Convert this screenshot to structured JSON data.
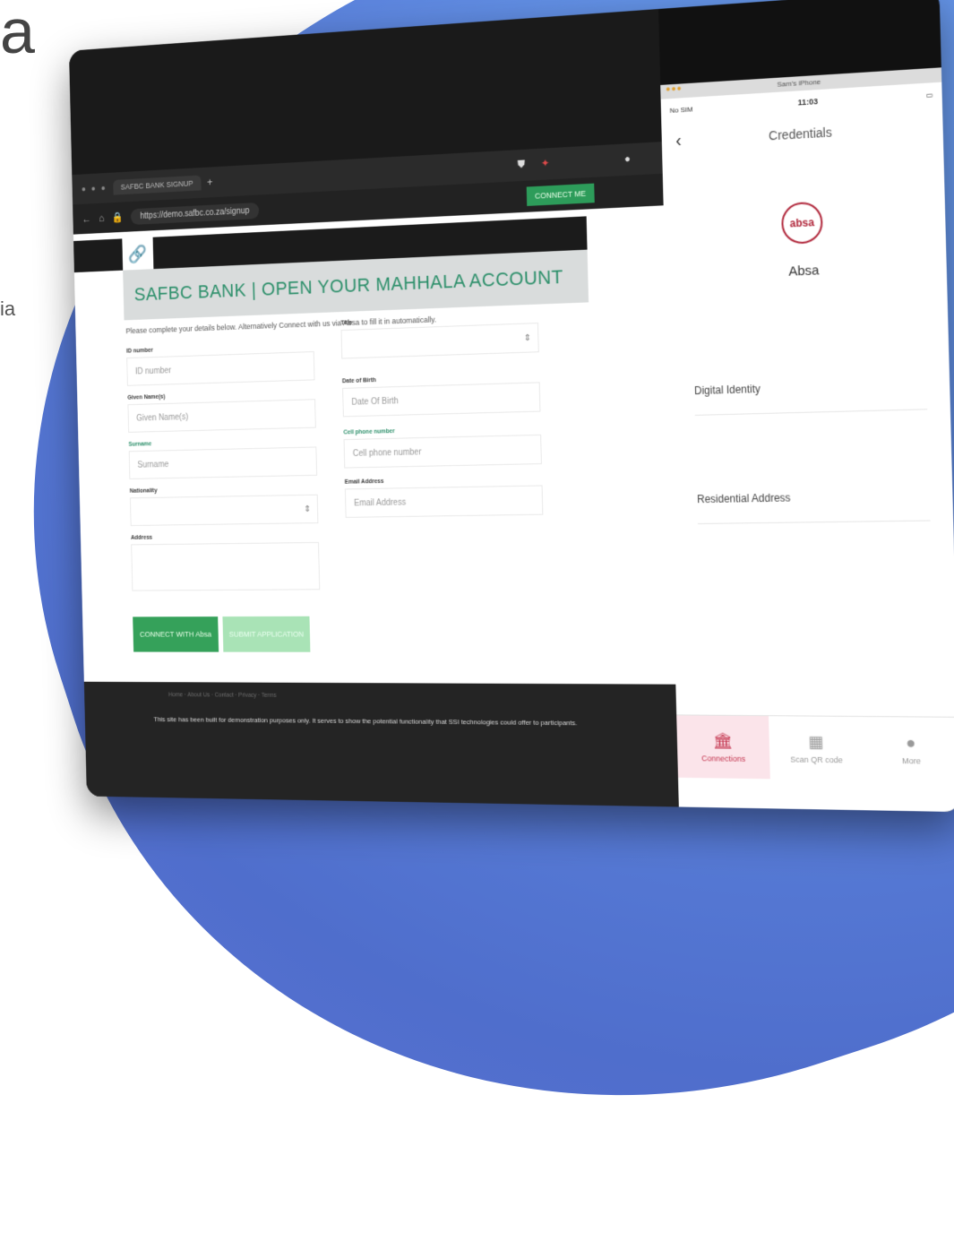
{
  "background": {
    "partial_title": "a",
    "partial_text": "ia"
  },
  "browser": {
    "tab_title": "SAFBC BANK SIGNUP",
    "new_tab": "+",
    "url": "https://demo.safbc.co.za/signup",
    "connect_button": "CONNECT ME",
    "page": {
      "title": "SAFBC BANK | OPEN YOUR MAHHALA ACCOUNT",
      "intro": "Please complete your details below. Alternatively Connect with us via Absa to fill it in automatically.",
      "fields_left": [
        {
          "label": "ID number",
          "placeholder": "ID number",
          "type": "text"
        },
        {
          "label": "Given Name(s)",
          "placeholder": "Given Name(s)",
          "type": "text"
        },
        {
          "label": "Surname",
          "placeholder": "Surname",
          "type": "text"
        },
        {
          "label": "Nationality",
          "placeholder": "",
          "type": "select"
        },
        {
          "label": "Address",
          "placeholder": "",
          "type": "area"
        }
      ],
      "fields_right": [
        {
          "label": "Title",
          "placeholder": "",
          "type": "select"
        },
        {
          "label": "Date of Birth",
          "placeholder": "Date Of Birth",
          "type": "text"
        },
        {
          "label": "Cell phone number",
          "placeholder": "Cell phone number",
          "type": "text"
        },
        {
          "label": "Email Address",
          "placeholder": "Email Address",
          "type": "text"
        }
      ],
      "connect_with_button": "CONNECT WITH Absa",
      "submit_button": "SUBMIT APPLICATION"
    },
    "footer": {
      "links": "Home · About Us · Contact · Privacy · Terms",
      "text": "This site has been built for demonstration purposes only. It serves to show the potential functionality that SSI technologies could offer to participants."
    }
  },
  "phone": {
    "window_title": "Sam's iPhone",
    "carrier": "No SIM",
    "time": "11:03",
    "nav_title": "Credentials",
    "org_logo_text": "absa",
    "org_name": "Absa",
    "credentials": [
      "Digital Identity",
      "Residential Address"
    ],
    "tabs": [
      {
        "label": "Connections",
        "icon": "bank-icon",
        "active": true
      },
      {
        "label": "Scan QR code",
        "icon": "qr-icon",
        "active": false
      },
      {
        "label": "More",
        "icon": "more-icon",
        "active": false
      }
    ]
  },
  "colors": {
    "accent_green": "#2c8f6a",
    "button_green": "#35a15a",
    "absa_red": "#b0263a",
    "blob_blue": "#5b83dc"
  }
}
